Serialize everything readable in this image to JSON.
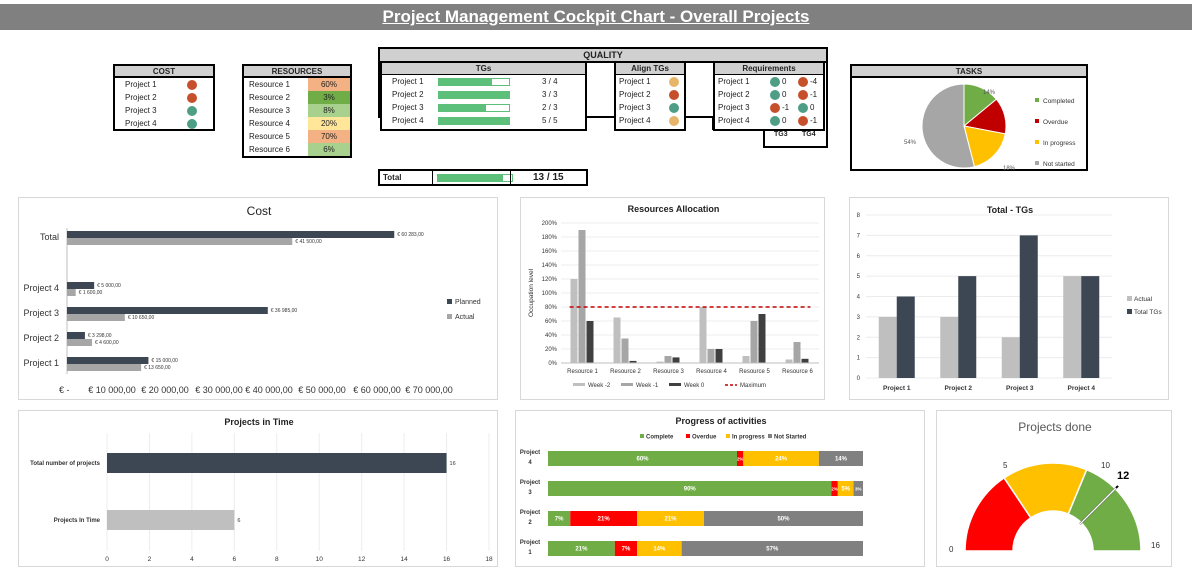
{
  "banner": {
    "title": "Project Management Cockpit Chart - Overall Projects"
  },
  "colors": {
    "red": "#c5502b",
    "green": "#4e9e86",
    "orange": "#e6b56a",
    "dark": "#3d4653",
    "gray": "#a6a6a6",
    "pgreen": "#70ad47",
    "pred": "#ff0000",
    "pyellow": "#ffc000",
    "pgray": "#808080"
  },
  "cost_table": {
    "header": "COST",
    "rows": [
      {
        "name": "Project 1",
        "status": "red"
      },
      {
        "name": "Project 2",
        "status": "red"
      },
      {
        "name": "Project 3",
        "status": "green"
      },
      {
        "name": "Project 4",
        "status": "green"
      }
    ]
  },
  "resources_table": {
    "header": "RESOURCES",
    "rows": [
      {
        "name": "Resource 1",
        "pct": "60%",
        "color": "#f4b183"
      },
      {
        "name": "Resource 2",
        "pct": "3%",
        "color": "#70ad47"
      },
      {
        "name": "Resource 3",
        "pct": "8%",
        "color": "#a9d18e"
      },
      {
        "name": "Resource 4",
        "pct": "20%",
        "color": "#ffe699"
      },
      {
        "name": "Resource 5",
        "pct": "70%",
        "color": "#f4b183"
      },
      {
        "name": "Resource 6",
        "pct": "6%",
        "color": "#a9d18e"
      }
    ]
  },
  "quality": {
    "header": "QUALITY",
    "tgs_header": "TGs",
    "align_header": "Align TGs",
    "req_header": "Requirements",
    "tg3_label": "TG3",
    "tg4_label": "TG4",
    "rows": [
      {
        "name": "Project 1",
        "fill": 0.75,
        "tg": "3  /  4",
        "align": "orange",
        "r3": "0",
        "r3c": "green",
        "r4": "-4",
        "r4c": "red"
      },
      {
        "name": "Project 2",
        "fill": 1.0,
        "tg": "3  /  3",
        "align": "red",
        "r3": "0",
        "r3c": "green",
        "r4": "-1",
        "r4c": "red"
      },
      {
        "name": "Project 3",
        "fill": 0.67,
        "tg": "2  /  3",
        "align": "green",
        "r3": "-1",
        "r3c": "red",
        "r4": "0",
        "r4c": "green"
      },
      {
        "name": "Project 4",
        "fill": 1.0,
        "tg": "5  /  5",
        "align": "orange",
        "r3": "0",
        "r3c": "green",
        "r4": "-1",
        "r4c": "red"
      }
    ],
    "total_label": "Total",
    "total_fill": 0.87,
    "total_value": "13  /  15"
  },
  "tasks": {
    "header": "TASKS",
    "slices": [
      {
        "name": "Completed",
        "value": 14,
        "label": "14%",
        "color": "#70ad47"
      },
      {
        "name": "Overdue",
        "value": 14,
        "label": "",
        "color": "#c00000"
      },
      {
        "name": "In progress",
        "value": 18,
        "label": "18%",
        "color": "#ffc000"
      },
      {
        "name": "Not started",
        "value": 54,
        "label": "54%",
        "color": "#a6a6a6"
      }
    ]
  },
  "chart_data": [
    {
      "type": "bar",
      "title": "Cost",
      "orientation": "horizontal",
      "categories": [
        "Project 1",
        "Project 2",
        "Project 3",
        "Project 4",
        "",
        "Total"
      ],
      "series": [
        {
          "name": "Planned",
          "values": [
            15000,
            3298,
            36985,
            5000,
            null,
            60283
          ],
          "labels": [
            "€ 15 000,00",
            "€ 3 298,00",
            "€ 36 985,00",
            "€ 5 000,00",
            "",
            "€ 60 283,00"
          ]
        },
        {
          "name": "Actual",
          "values": [
            13650,
            4600,
            10650,
            1600,
            null,
            41500
          ],
          "labels": [
            "€ 13 650,00",
            "€ 4 600,00",
            "€ 10 650,00",
            "€ 1 600,00",
            "",
            "€ 41 500,00"
          ]
        }
      ],
      "xlim": [
        0,
        70000
      ],
      "xticks": [
        "€ -",
        "€ 10 000,00",
        "€ 20 000,00",
        "€ 30 000,00",
        "€ 40 000,00",
        "€ 50 000,00",
        "€ 60 000,00",
        "€ 70 000,00"
      ]
    },
    {
      "type": "bar",
      "title": "Resources Allocation",
      "ylabel": "Occupation level",
      "categories": [
        "Resource 1",
        "Resource 2",
        "Resource 3",
        "Resource 4",
        "Resource 5",
        "Resource 6"
      ],
      "series": [
        {
          "name": "Week -2",
          "values": [
            120,
            65,
            2,
            80,
            10,
            5
          ]
        },
        {
          "name": "Week -1",
          "values": [
            190,
            35,
            10,
            20,
            60,
            30
          ]
        },
        {
          "name": "Week 0",
          "values": [
            60,
            3,
            8,
            20,
            70,
            6
          ]
        },
        {
          "name": "Maximum",
          "values": [
            80,
            80,
            80,
            80,
            80,
            80
          ]
        }
      ],
      "ylim": [
        0,
        200
      ],
      "yticks": [
        "0%",
        "20%",
        "40%",
        "60%",
        "80%",
        "100%",
        "120%",
        "140%",
        "160%",
        "180%",
        "200%"
      ]
    },
    {
      "type": "bar",
      "title": "Total - TGs",
      "categories": [
        "Project 1",
        "Project 2",
        "Project 3",
        "Project 4"
      ],
      "series": [
        {
          "name": "Actual",
          "values": [
            3,
            3,
            2,
            5
          ]
        },
        {
          "name": "Total TGs",
          "values": [
            4,
            5,
            7,
            5
          ]
        }
      ],
      "ylim": [
        0,
        8
      ]
    },
    {
      "type": "bar",
      "title": "Projects in Time",
      "orientation": "horizontal",
      "categories": [
        "Projects In Time",
        "Total number of projects"
      ],
      "values": [
        6,
        16
      ],
      "xlim": [
        0,
        18
      ],
      "xticks": [
        "0",
        "2",
        "4",
        "6",
        "8",
        "10",
        "12",
        "14",
        "16",
        "18"
      ]
    },
    {
      "type": "bar",
      "title": "Progress of activities",
      "stacked": true,
      "orientation": "horizontal",
      "categories": [
        "Project 4",
        "Project 3",
        "Project 2",
        "Project 1"
      ],
      "series": [
        {
          "name": "Complete",
          "values": [
            60,
            90,
            7,
            21
          ],
          "labels": [
            "60%",
            "90%",
            "7%",
            "21%"
          ]
        },
        {
          "name": "Overdue",
          "values": [
            2,
            2,
            21,
            7
          ],
          "labels": [
            "2%",
            "2%",
            "21%",
            "7%"
          ]
        },
        {
          "name": "In progress",
          "values": [
            24,
            5,
            21,
            14
          ],
          "labels": [
            "24%",
            "5%",
            "21%",
            "14%"
          ]
        },
        {
          "name": "Not Started",
          "values": [
            14,
            3,
            50,
            57
          ],
          "labels": [
            "14%",
            "3%",
            "50%",
            "57%"
          ]
        }
      ]
    },
    {
      "type": "gauge",
      "title": "Projects done",
      "value": 12,
      "value_label": "12",
      "bands": [
        {
          "from": 0,
          "to": 5,
          "color": "#ff0000"
        },
        {
          "from": 5,
          "to": 10,
          "color": "#ffc000"
        },
        {
          "from": 10,
          "to": 16,
          "color": "#70ad47"
        }
      ],
      "tick_labels": [
        "0",
        "5",
        "10",
        "16"
      ]
    }
  ]
}
